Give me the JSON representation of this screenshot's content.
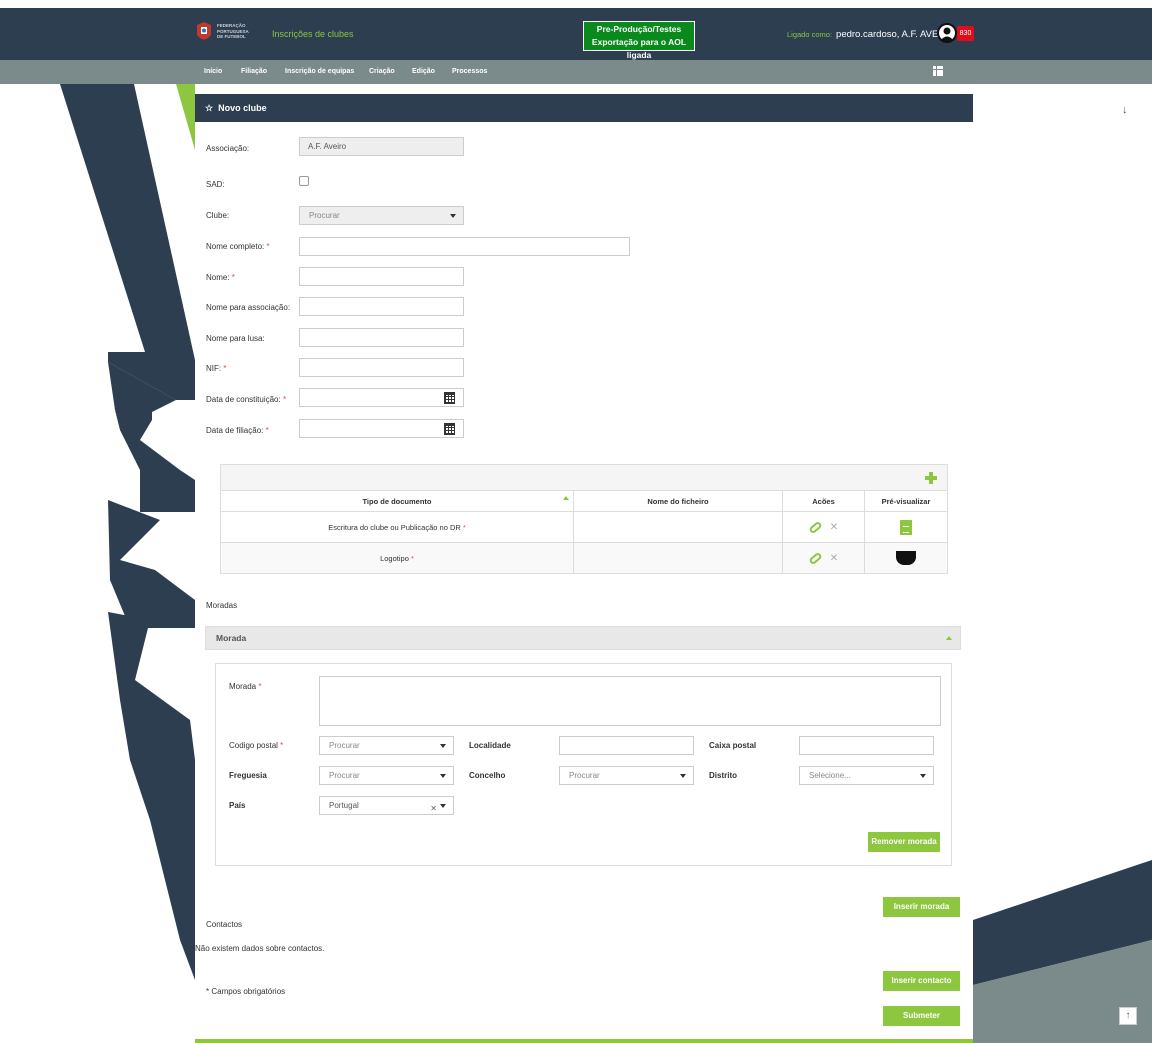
{
  "header": {
    "org_name": "FEDERAÇÃO\nPORTUGUESA\nDE FUTEBOL",
    "app_title": "Inscrições de clubes",
    "env_line1": "Pre-Produção/Testes",
    "env_line2": "Exportação para o AOL ligada",
    "login_label": "Ligado como:",
    "login_user": "pedro.cardoso, A.F. AVEIRO",
    "badge": "830"
  },
  "nav": {
    "items": [
      "Início",
      "Filiação",
      "Inscrição de equipas",
      "Criação",
      "Edição",
      "Processos"
    ]
  },
  "form": {
    "title": "Novo clube",
    "associacao_label": "Associação:",
    "associacao_value": "A.F. Aveiro",
    "sad_label": "SAD:",
    "clube_label": "Clube:",
    "clube_placeholder": "Procurar",
    "nome_completo_label": "Nome completo:",
    "nome_label": "Nome:",
    "nome_associacao_label": "Nome para associação:",
    "nome_lusa_label": "Nome para lusa:",
    "nif_label": "NIF:",
    "data_constituicao_label": "Data de constituição:",
    "data_filiacao_label": "Data de filiação:",
    "required_mark": "*"
  },
  "documents": {
    "columns": [
      "Tipo de documento",
      "Nome do ficheiro",
      "Acões",
      "Pré-visualizar"
    ],
    "rows": [
      {
        "tipo": "Escritura do clube ou Publicação no DR",
        "ficheiro": ""
      },
      {
        "tipo": "Logotipo",
        "ficheiro": ""
      }
    ]
  },
  "moradas": {
    "section_title": "Moradas",
    "panel_title": "Morada",
    "morada_label": "Morada",
    "codigo_postal_label": "Codigo postal",
    "codigo_postal_placeholder": "Procurar",
    "localidade_label": "Localidade",
    "caixa_postal_label": "Caixa postal",
    "freguesia_label": "Freguesia",
    "freguesia_placeholder": "Procurar",
    "concelho_label": "Concelho",
    "concelho_placeholder": "Procurar",
    "distrito_label": "Distrito",
    "distrito_placeholder": "Selecione...",
    "pais_label": "País",
    "pais_value": "Portugal",
    "remove_button": "Remover morada",
    "insert_button": "Inserir morada"
  },
  "contactos": {
    "section_title": "Contactos",
    "empty_text": "Não existem dados sobre contactos.",
    "insert_button": "Inserir contacto"
  },
  "footer": {
    "required_note": "* Campos obrigatórios",
    "submit_button": "Submeter"
  },
  "colors": {
    "navy": "#2c3e50",
    "accent_green": "#8dc63f",
    "nav_grey": "#7b8a8a"
  }
}
